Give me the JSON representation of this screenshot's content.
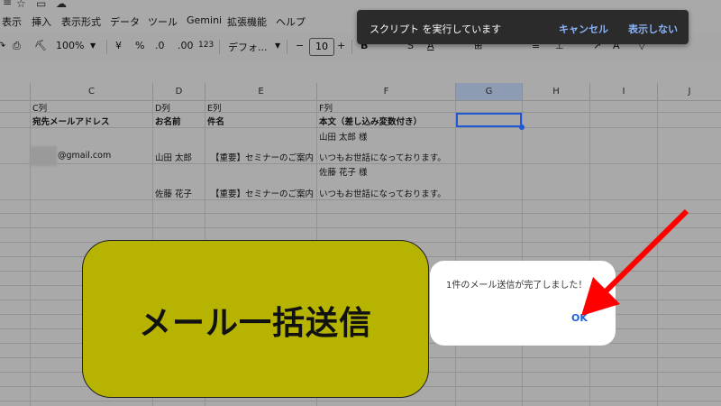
{
  "menu": [
    "表示",
    "挿入",
    "表示形式",
    "データ",
    "ツール",
    "Gemini",
    "拡張機能",
    "ヘルプ"
  ],
  "toolbar": {
    "zoom": "100%",
    "currency": "¥",
    "percent": "%",
    "dec_decrease": ".0",
    "dec_increase": ".00",
    "number_format": "123",
    "font": "デフォ...",
    "font_size": "10",
    "minus": "−",
    "plus": "+"
  },
  "columns": [
    "C",
    "D",
    "E",
    "F",
    "G",
    "H",
    "I",
    "J"
  ],
  "rows": {
    "row1": [
      "C列",
      "D列",
      "E列",
      "F列"
    ],
    "row2": [
      "宛先メールアドレス",
      "お名前",
      "件名",
      "本文（差し込み変数付き）"
    ],
    "row3": {
      "email": "@gmail.com",
      "name": "山田 太郎",
      "subject": "【重要】セミナーのご案内",
      "body_line1": "山田 太郎 様",
      "body_line2": "いつもお世話になっております。"
    },
    "row4": {
      "name": "佐藤 花子",
      "subject": "【重要】セミナーのご案内",
      "body_line1": "佐藤 花子 様",
      "body_line2": "いつもお世話になっております。"
    }
  },
  "toast": {
    "message": "スクリプト を実行しています",
    "cancel": "キャンセル",
    "hide": "表示しない"
  },
  "button": {
    "label": "メール一括送信"
  },
  "dialog": {
    "message": "1件のメール送信が完了しました！",
    "ok": "OK"
  },
  "colors": {
    "arrow": "#ff0000",
    "button_fill": "#b6b400",
    "accent": "#1a62d9"
  }
}
